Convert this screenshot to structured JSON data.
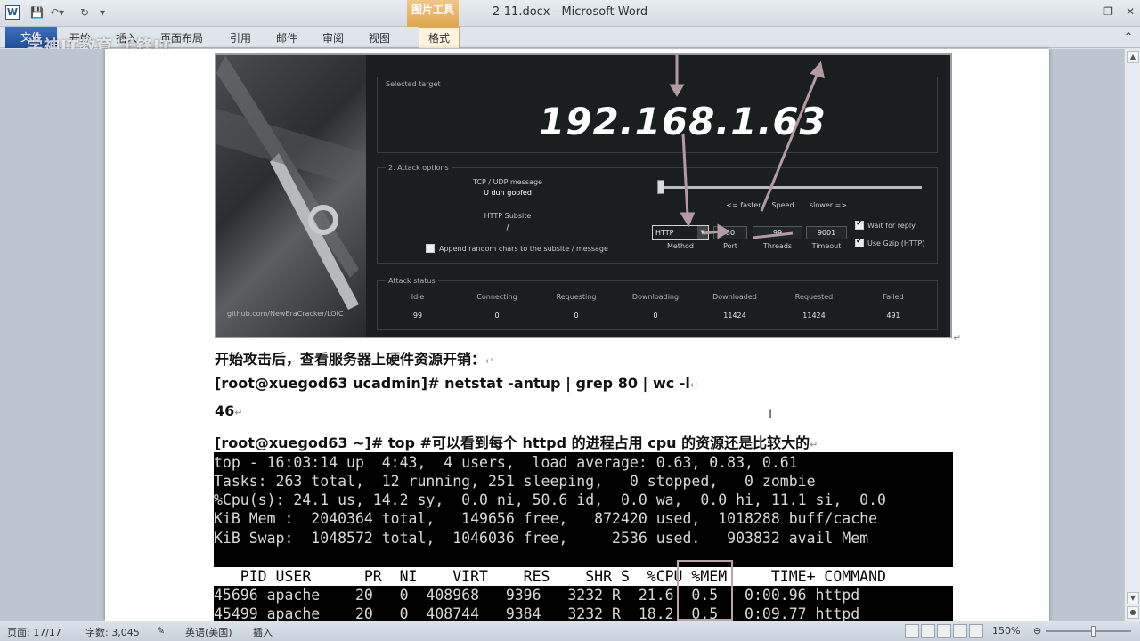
{
  "titlebar": {
    "title": "2-11.docx - Microsoft Word",
    "picture_tools": "图片工具",
    "icon_text": "W",
    "window_controls": [
      "–",
      "❐",
      "✕"
    ]
  },
  "ribbon": {
    "tabs": [
      "文件",
      "开始",
      "插入",
      "页面布局",
      "引用",
      "邮件",
      "审阅",
      "视图",
      "格式"
    ],
    "watermark": "学神IT教育 千锋IT"
  },
  "loic": {
    "selected_target_label": "Selected target",
    "ip": "192.168.1.63",
    "attack_options_label": "2. Attack options",
    "tcp_udp_label": "TCP / UDP message",
    "tcp_udp_value": "U dun goofed",
    "http_subsite_label": "HTTP Subsite",
    "http_subsite_value": "/",
    "append_label": "Append random chars to the subsite / message",
    "faster": "<= faster",
    "speed": "Speed",
    "slower": "slower =>",
    "method_value": "HTTP",
    "method_label": "Method",
    "port_value": "80",
    "port_label": "Port",
    "threads_value": "99",
    "threads_label": "Threads",
    "timeout_value": "9001",
    "timeout_label": "Timeout",
    "wait_reply": "Wait for reply",
    "use_gzip": "Use Gzip (HTTP)",
    "attack_status_label": "Attack status",
    "status_headers": [
      "Idle",
      "Connecting",
      "Requesting",
      "Downloading",
      "Downloaded",
      "Requested",
      "Failed"
    ],
    "status_values": [
      "99",
      "0",
      "0",
      "0",
      "11424",
      "11424",
      "491"
    ],
    "github": "github.com/NewEraCracker/LOIC"
  },
  "doc": {
    "line1": "开始攻击后，查看服务器上硬件资源开销：",
    "line2": "[root@xuegod63 ucadmin]#  netstat   -antup | grep 80 | wc -l",
    "line3": "46",
    "line4": "[root@xuegod63 ~]# top   #可以看到每个 httpd 的进程占用 cpu 的资源还是比较大的",
    "para_mark": "↵"
  },
  "terminal": {
    "lines": [
      "top - 16:03:14 up  4:43,  4 users,  load average: 0.63, 0.83, 0.61",
      "Tasks: 263 total,  12 running, 251 sleeping,   0 stopped,   0 zombie",
      "%Cpu(s): 24.1 us, 14.2 sy,  0.0 ni, 50.6 id,  0.0 wa,  0.0 hi, 11.1 si,  0.0",
      "KiB Mem :  2040364 total,   149656 free,   872420 used,  1018288 buff/cache",
      "KiB Swap:  1048572 total,  1046036 free,     2536 used.   903832 avail Mem "
    ],
    "header": "   PID USER      PR  NI    VIRT    RES    SHR S  %CPU %MEM     TIME+ COMMAND",
    "rows": [
      "45696 apache    20   0  408968   9396   3232 R  21.6  0.5   0:00.96 httpd",
      "45499 apache    20   0  408744   9384   3232 R  18.2  0.5   0:09.77 httpd"
    ]
  },
  "statusbar": {
    "page": "页面: 17/17",
    "words": "字数: 3,045",
    "language": "英语(美国)",
    "mode": "插入",
    "zoom": "150%"
  }
}
